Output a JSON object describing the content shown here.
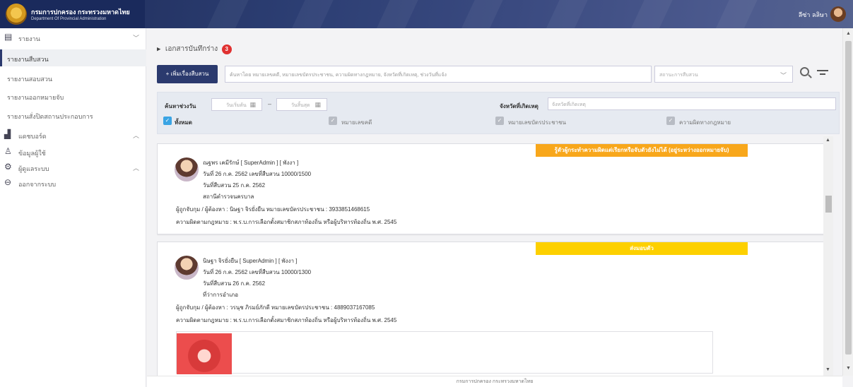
{
  "header": {
    "org_th": "กรมการปกครอง กระทรวงมหาดไทย",
    "org_en": "Department Of Provincial Administration",
    "user_name": "ลีซ่า ลลิษา"
  },
  "sidebar": {
    "groups": [
      {
        "label": "รายงาน",
        "icon": "report-icon",
        "chevron": "﹀"
      },
      {
        "label": "แดชบอร์ด",
        "icon": "chart-icon",
        "chevron": "︿"
      },
      {
        "label": "ข้อมูลผู้ใช้",
        "icon": "user-icon"
      },
      {
        "label": "ผู้ดูแลระบบ",
        "icon": "gear-icon",
        "chevron": "︿"
      },
      {
        "label": "ออกจากระบบ",
        "icon": "logout-icon"
      }
    ],
    "report_items": [
      "รายงานสืบสวน",
      "รายงานสอบสวน",
      "รายงานออกหมายจับ",
      "รายงานสั่งปิดสถานประกอบการ"
    ]
  },
  "drafts": {
    "label": "เอกสารบันทึกร่าง",
    "count": "3"
  },
  "toolbar": {
    "add_label": "+ เพิ่มเรื่องสืบสวน",
    "search_placeholder": "ค้นหาโดย หมายเลขคดี, หมายเลขบัตรประชาชน, ความผิดทางกฎหมาย, จังหวัดที่เกิดเหตุ, ช่วงวันที่แจ้ง",
    "status_placeholder": "สถานะการสืบสวน"
  },
  "filters": {
    "date_label": "ค้นหาช่วงวัน",
    "start_placeholder": "วันเริ่มต้น",
    "end_placeholder": "วันสิ้นสุด",
    "date_sep": "–",
    "province_label": "จังหวัดที่เกิดเหตุ",
    "province_placeholder": "จังหวัดที่เกิดเหตุ",
    "checkboxes": [
      {
        "label": "ทั้งหมด",
        "checked": true
      },
      {
        "label": "หมายเลขคดี",
        "checked": false
      },
      {
        "label": "หมายเลขบัตรประชาชน",
        "checked": false
      },
      {
        "label": "ความผิดทางกฎหมาย",
        "checked": false
      }
    ]
  },
  "cases": [
    {
      "status": "รู้ตัวผู้กระทำความผิดแต่เรียกหรือจับตัวยังไม่ได้ (อยู่ระหว่างออกหมายจับ)",
      "status_color": "#f8a71b",
      "author": "ณฐพร เคมีรักษ์ [ SuperAdmin ] [ พังงา ]",
      "date_line": "วันที่ 26 ก.ค. 2562 เลขที่สืบสวน 10000/1500",
      "investigate_date": "วันที่สืบสวน 25 ก.ค. 2562",
      "place": "สถานีตำรวจนครบาล",
      "suspect": "ผู้ถูกจับกุม / ผู้ต้องหา : นิษฐา จิรยั่งยืน หมายเลขบัตรประชาชน : 3933851468615",
      "offense": "ความผิดตามกฎหมาย : พ.ร.บ.การเลือกตั้งสมาชิกสภาท้องถิ่น หรือผู้บริหารท้องถิ่น พ.ศ. 2545"
    },
    {
      "status": "ส่งมอบตัว",
      "status_color": "#fdd000",
      "author": "นิษฐา จิรยั่งยืน [ SuperAdmin ] [ พังงา ]",
      "date_line": "วันที่ 26 ก.ค. 2562 เลขที่สืบสวน 10000/1300",
      "investigate_date": "วันที่สืบสวน 26 ก.ค. 2562",
      "place": "ที่ว่าการอำเภอ",
      "suspect": "ผู้ถูกจับกุม / ผู้ต้องหา : วรนุช ภิรมย์ภักดี หมายเลขบัตรประชาชน : 4889037167085",
      "offense": "ความผิดตามกฎหมาย : พ.ร.บ.การเลือกตั้งสมาชิกสภาท้องถิ่น หรือผู้บริหารท้องถิ่น พ.ศ. 2545"
    }
  ],
  "footer": {
    "text": "กรมการปกครอง กระทรวงมหาดไทย"
  }
}
